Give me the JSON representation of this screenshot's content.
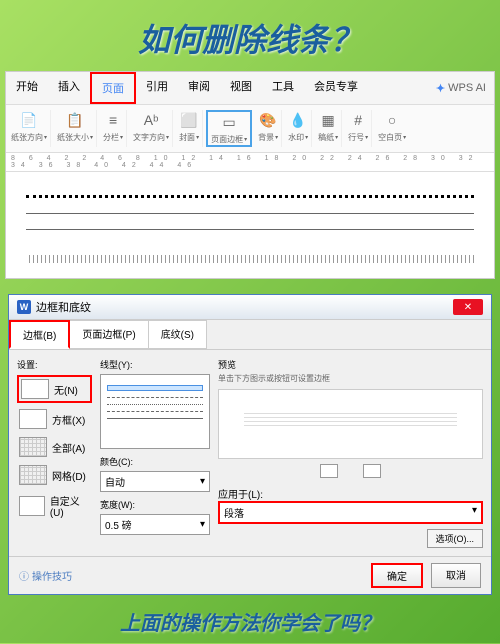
{
  "title": "如何删除线条？",
  "footer_text": "上面的操作方法你学会了吗？",
  "menu": {
    "items": [
      "开始",
      "插入",
      "页面",
      "引用",
      "审阅",
      "视图",
      "工具",
      "会员专享"
    ],
    "active_idx": 2,
    "ai": "WPS AI"
  },
  "ribbon": [
    {
      "icon": "📄",
      "label": "纸张方向"
    },
    {
      "icon": "📋",
      "label": "纸张大小"
    },
    {
      "icon": "≡",
      "label": "分栏"
    },
    {
      "icon": "Aᵇ",
      "label": "文字方向"
    },
    {
      "icon": "⬜",
      "label": "封面"
    },
    {
      "icon": "▭",
      "label": "页面边框",
      "highlight": true
    },
    {
      "icon": "🎨",
      "label": "背景"
    },
    {
      "icon": "💧",
      "label": "水印"
    },
    {
      "icon": "▦",
      "label": "稿纸"
    },
    {
      "icon": "#",
      "label": "行号"
    },
    {
      "icon": "○",
      "label": "空白页"
    }
  ],
  "ruler": "8 6 4 2 2 4 6 8 10 12 14 16 18 20 22 24 26 28 30 32 34 36 38 40 42 44 46",
  "dialog": {
    "title": "边框和底纹",
    "tabs": [
      "边框(B)",
      "页面边框(P)",
      "底纹(S)"
    ],
    "left_label": "设置:",
    "settings": [
      {
        "label": "无(N)",
        "hl": true
      },
      {
        "label": "方框(X)"
      },
      {
        "label": "全部(A)"
      },
      {
        "label": "网格(D)"
      },
      {
        "label": "自定义(U)"
      }
    ],
    "style_label": "线型(Y):",
    "color_label": "颜色(C):",
    "color_value": "自动",
    "width_label": "宽度(W):",
    "width_value": "0.5 磅",
    "preview_label": "预览",
    "preview_hint": "单击下方图示或按钮可设置边框",
    "apply_label": "应用于(L):",
    "apply_value": "段落",
    "options_btn": "选项(O)...",
    "tips": "操作技巧",
    "ok": "确定",
    "cancel": "取消"
  }
}
